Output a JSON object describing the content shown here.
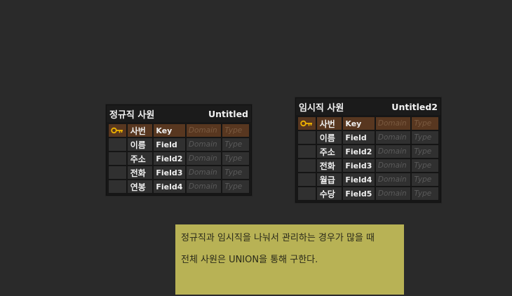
{
  "colors": {
    "canvas": "#2a2a2a",
    "entity_bg": "#171717",
    "cell_bg": "#303030",
    "pk_row_bg": "#583720",
    "key_icon": "#f0b400",
    "note_bg": "#b8b255"
  },
  "entities": [
    {
      "logical_name": "정규직 사원",
      "physical_name": "Untitled",
      "columns": [
        {
          "pk": true,
          "icon": "key-icon",
          "logical": "사번",
          "physical": "Key",
          "domain": "Domain",
          "type": "Type"
        },
        {
          "pk": false,
          "logical": "이름",
          "physical": "Field",
          "domain": "Domain",
          "type": "Type"
        },
        {
          "pk": false,
          "logical": "주소",
          "physical": "Field2",
          "domain": "Domain",
          "type": "Type"
        },
        {
          "pk": false,
          "logical": "전화",
          "physical": "Field3",
          "domain": "Domain",
          "type": "Type"
        },
        {
          "pk": false,
          "logical": "연봉",
          "physical": "Field4",
          "domain": "Domain",
          "type": "Type"
        }
      ]
    },
    {
      "logical_name": "임시직 사원",
      "physical_name": "Untitled2",
      "columns": [
        {
          "pk": true,
          "icon": "key-icon",
          "logical": "사번",
          "physical": "Key",
          "domain": "Domain",
          "type": "Type"
        },
        {
          "pk": false,
          "logical": "이름",
          "physical": "Field",
          "domain": "Domain",
          "type": "Type"
        },
        {
          "pk": false,
          "logical": "주소",
          "physical": "Field2",
          "domain": "Domain",
          "type": "Type"
        },
        {
          "pk": false,
          "logical": "전화",
          "physical": "Field3",
          "domain": "Domain",
          "type": "Type"
        },
        {
          "pk": false,
          "logical": "월급",
          "physical": "Field4",
          "domain": "Domain",
          "type": "Type"
        },
        {
          "pk": false,
          "logical": "수당",
          "physical": "Field5",
          "domain": "Domain",
          "type": "Type"
        }
      ]
    }
  ],
  "note": {
    "lines": [
      "정규직과 임시직을 나눠서 관리하는 경우가 많을 때",
      "전체 사원은 UNION을 통해 구한다."
    ]
  }
}
